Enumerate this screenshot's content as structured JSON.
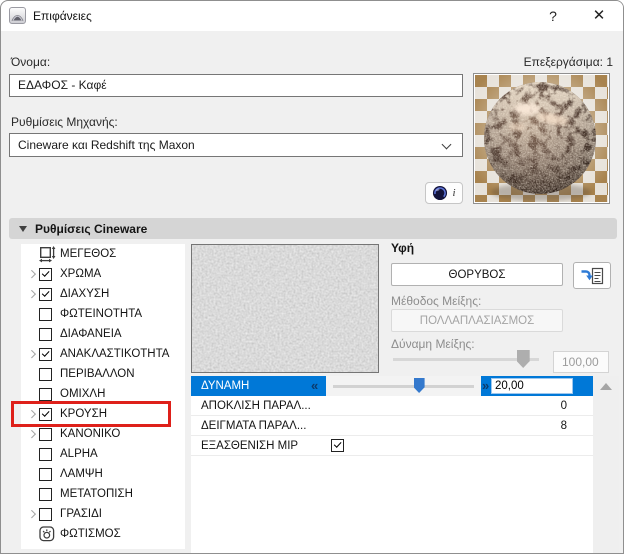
{
  "window": {
    "title": "Επιφάνειες",
    "help_label": "?",
    "close_label": "✕"
  },
  "header": {
    "name_label": "Όνομα:",
    "name_value": "ΕΔΑΦΟΣ - Καφέ",
    "editable_label": "Επεξεργάσιμα: 1",
    "engine_label": "Ρυθμίσεις Μηχανής:",
    "engine_value": "Cineware και Redshift της Maxon",
    "info_label": "i"
  },
  "section": {
    "title": "Ρυθμίσεις Cineware"
  },
  "channels": [
    {
      "label": "ΜΕΓΕΘΟΣ",
      "expander": false,
      "control": "size-icon",
      "checked": false,
      "highlighted": false
    },
    {
      "label": "ΧΡΩΜΑ",
      "expander": true,
      "control": "checkbox",
      "checked": true,
      "highlighted": false
    },
    {
      "label": "ΔΙΑΧΥΣΗ",
      "expander": true,
      "control": "checkbox",
      "checked": true,
      "highlighted": false
    },
    {
      "label": "ΦΩΤΕΙΝΟΤΗΤΑ",
      "expander": false,
      "control": "checkbox",
      "checked": false,
      "highlighted": false
    },
    {
      "label": "ΔΙΑΦΑΝΕΙΑ",
      "expander": false,
      "control": "checkbox",
      "checked": false,
      "highlighted": false
    },
    {
      "label": "ΑΝΑΚΛΑΣΤΙΚΟΤΗΤΑ",
      "expander": true,
      "control": "checkbox",
      "checked": true,
      "highlighted": false
    },
    {
      "label": "ΠΕΡΙΒΑΛΛΟΝ",
      "expander": false,
      "control": "checkbox",
      "checked": false,
      "highlighted": false
    },
    {
      "label": "ΟΜΙΧΛΗ",
      "expander": false,
      "control": "checkbox",
      "checked": false,
      "highlighted": false
    },
    {
      "label": "ΚΡΟΥΣΗ",
      "expander": true,
      "control": "checkbox",
      "checked": true,
      "highlighted": true
    },
    {
      "label": "ΚΑΝΟΝΙΚΟ",
      "expander": true,
      "control": "checkbox",
      "checked": false,
      "highlighted": false
    },
    {
      "label": "ALPHA",
      "expander": false,
      "control": "checkbox",
      "checked": false,
      "highlighted": false
    },
    {
      "label": "ΛΑΜΨΗ",
      "expander": false,
      "control": "checkbox",
      "checked": false,
      "highlighted": false
    },
    {
      "label": "ΜΕΤΑΤΟΠΙΣΗ",
      "expander": false,
      "control": "checkbox",
      "checked": false,
      "highlighted": false
    },
    {
      "label": "ΓΡΑΣΙΔΙ",
      "expander": true,
      "control": "checkbox",
      "checked": false,
      "highlighted": false
    },
    {
      "label": "ΦΩΤΙΣΜΟΣ",
      "expander": false,
      "control": "light-icon",
      "checked": false,
      "highlighted": false
    }
  ],
  "texture_panel": {
    "texture_label": "Υφή",
    "texture_button": "ΘΟΡΥΒΟΣ",
    "mix_method_label": "Μέθοδος Μείξης:",
    "mix_method_value": "ΠΟΛΛΑΠΛΑΣΙΑΣΜΟΣ",
    "mix_strength_label": "Δύναμη Μείξης:",
    "mix_strength_value": "100,00",
    "mix_strength_position": 0.93
  },
  "properties": {
    "rows": [
      {
        "label": "ΔΥΝΑΜΗ",
        "type": "slider",
        "value": "20,00",
        "selected": true,
        "slider_position": 0.62
      },
      {
        "label": "ΑΠΟΚΛΙΣΗ ΠΑΡΑΛ...",
        "type": "value",
        "value": "0",
        "selected": false
      },
      {
        "label": "ΔΕΙΓΜΑΤΑ ΠΑΡΑΛ...",
        "type": "value",
        "value": "8",
        "selected": false
      },
      {
        "label": "ΕΞΑΣΘΕΝΙΣΗ MIP",
        "type": "checkbox",
        "checked": true,
        "selected": false
      }
    ]
  },
  "colors": {
    "accent": "#0078d7",
    "annotation_red": "#de201a",
    "section_bar": "#d5d5d5"
  }
}
